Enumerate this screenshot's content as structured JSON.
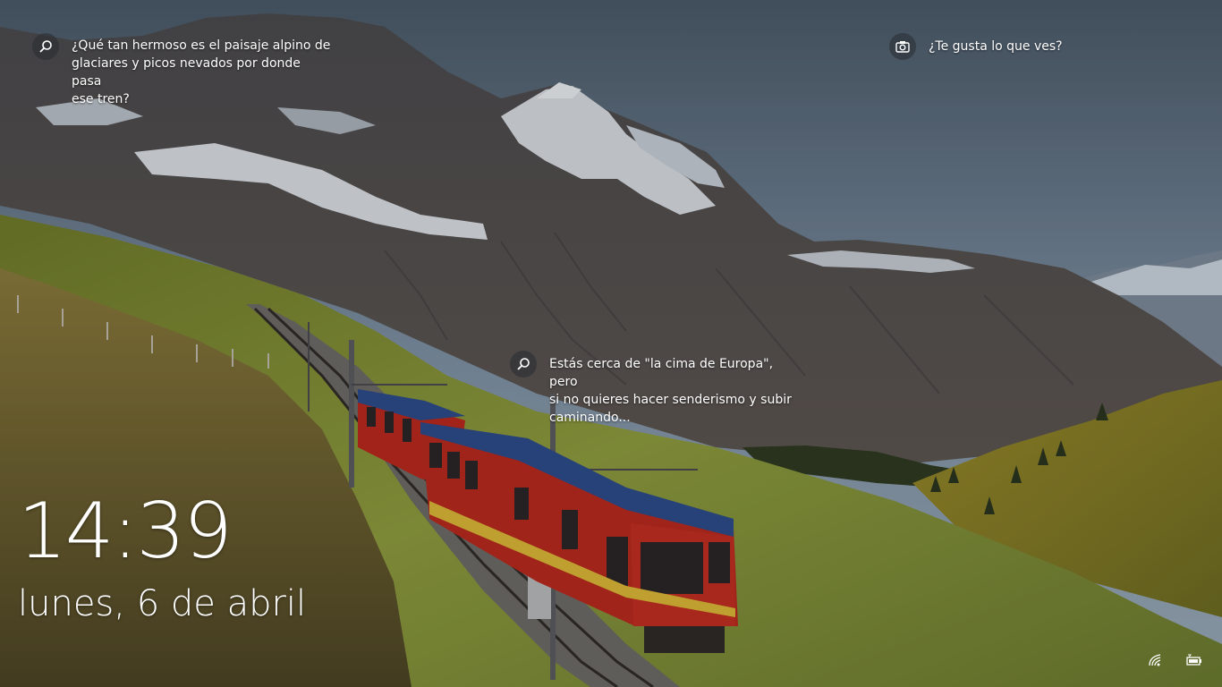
{
  "lock_screen": {
    "time": "14:39",
    "date": "lunes, 6 de abril",
    "hotspots": {
      "top": {
        "text": "¿Qué tan hermoso es el paisaje alpino de\nglaciares y picos nevados por donde pasa\nese tren?",
        "icon": "search-icon"
      },
      "middle": {
        "text": "Estás cerca de \"la cima de Europa\", pero\nsi no quieres hacer senderismo y subir\ncaminando...",
        "icon": "search-icon"
      }
    },
    "like_prompt": {
      "text": "¿Te gusta lo que ves?",
      "icon": "camera-icon"
    },
    "tray": {
      "network_icon": "wifi-icon",
      "battery_icon": "battery-charging-icon"
    }
  },
  "colors": {
    "text": "#ffffff",
    "badge_bg": "#2a2d33",
    "sky": "#7f93a6",
    "grass": "#8a9a38",
    "train_red": "#b8281e",
    "train_roof": "#2d4a8a"
  }
}
